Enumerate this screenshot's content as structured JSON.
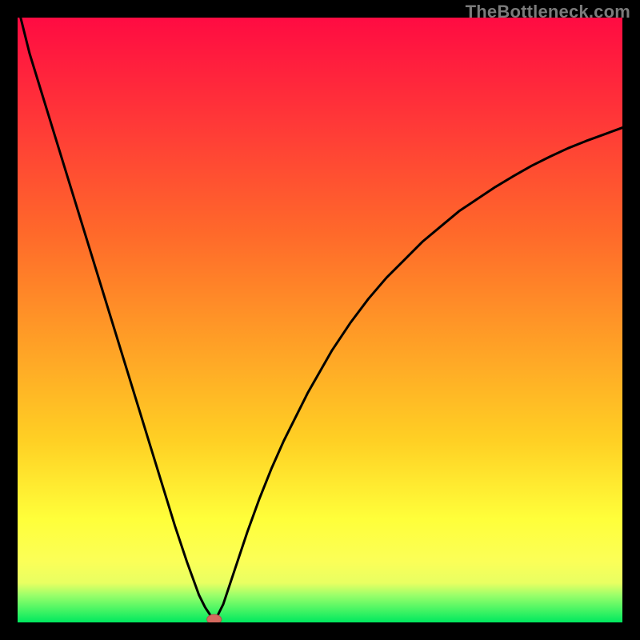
{
  "watermark": "TheBottleneck.com",
  "colors": {
    "frame": "#000000",
    "gradient_top": "#ff0b42",
    "gradient_mid_upper": "#ff6a2a",
    "gradient_mid": "#ffd024",
    "gradient_lower": "#fbff58",
    "gradient_green_band": "#9bff6a",
    "gradient_bottom": "#00e85f",
    "curve": "#000000",
    "marker_fill": "#d46a5f",
    "marker_stroke": "#b2534a"
  },
  "chart_data": {
    "type": "line",
    "title": "",
    "xlabel": "",
    "ylabel": "",
    "xlim": [
      0,
      100
    ],
    "ylim": [
      0,
      100
    ],
    "series": [
      {
        "name": "bottleneck-curve",
        "x": [
          0.5,
          2,
          4,
          6,
          8,
          10,
          12,
          14,
          16,
          18,
          20,
          22,
          24,
          26,
          28,
          30,
          31,
          32,
          32.5,
          33,
          34,
          36,
          38,
          40,
          42,
          44,
          46,
          48,
          50,
          52,
          55,
          58,
          61,
          64,
          67,
          70,
          73,
          76,
          79,
          82,
          85,
          88,
          91,
          94,
          97,
          100
        ],
        "values": [
          100,
          94,
          87.5,
          81,
          74.5,
          68,
          61.5,
          55,
          48.5,
          42,
          35.5,
          29,
          22.5,
          16,
          10,
          4.5,
          2.5,
          1,
          0.5,
          1,
          3,
          9,
          15,
          20.5,
          25.5,
          30,
          34,
          38,
          41.5,
          45,
          49.5,
          53.5,
          57,
          60,
          63,
          65.5,
          68,
          70,
          72,
          73.8,
          75.5,
          77,
          78.4,
          79.6,
          80.7,
          81.8
        ]
      }
    ],
    "marker": {
      "x": 32.5,
      "y": 0.5,
      "rx": 1.2,
      "ry": 0.8
    }
  }
}
